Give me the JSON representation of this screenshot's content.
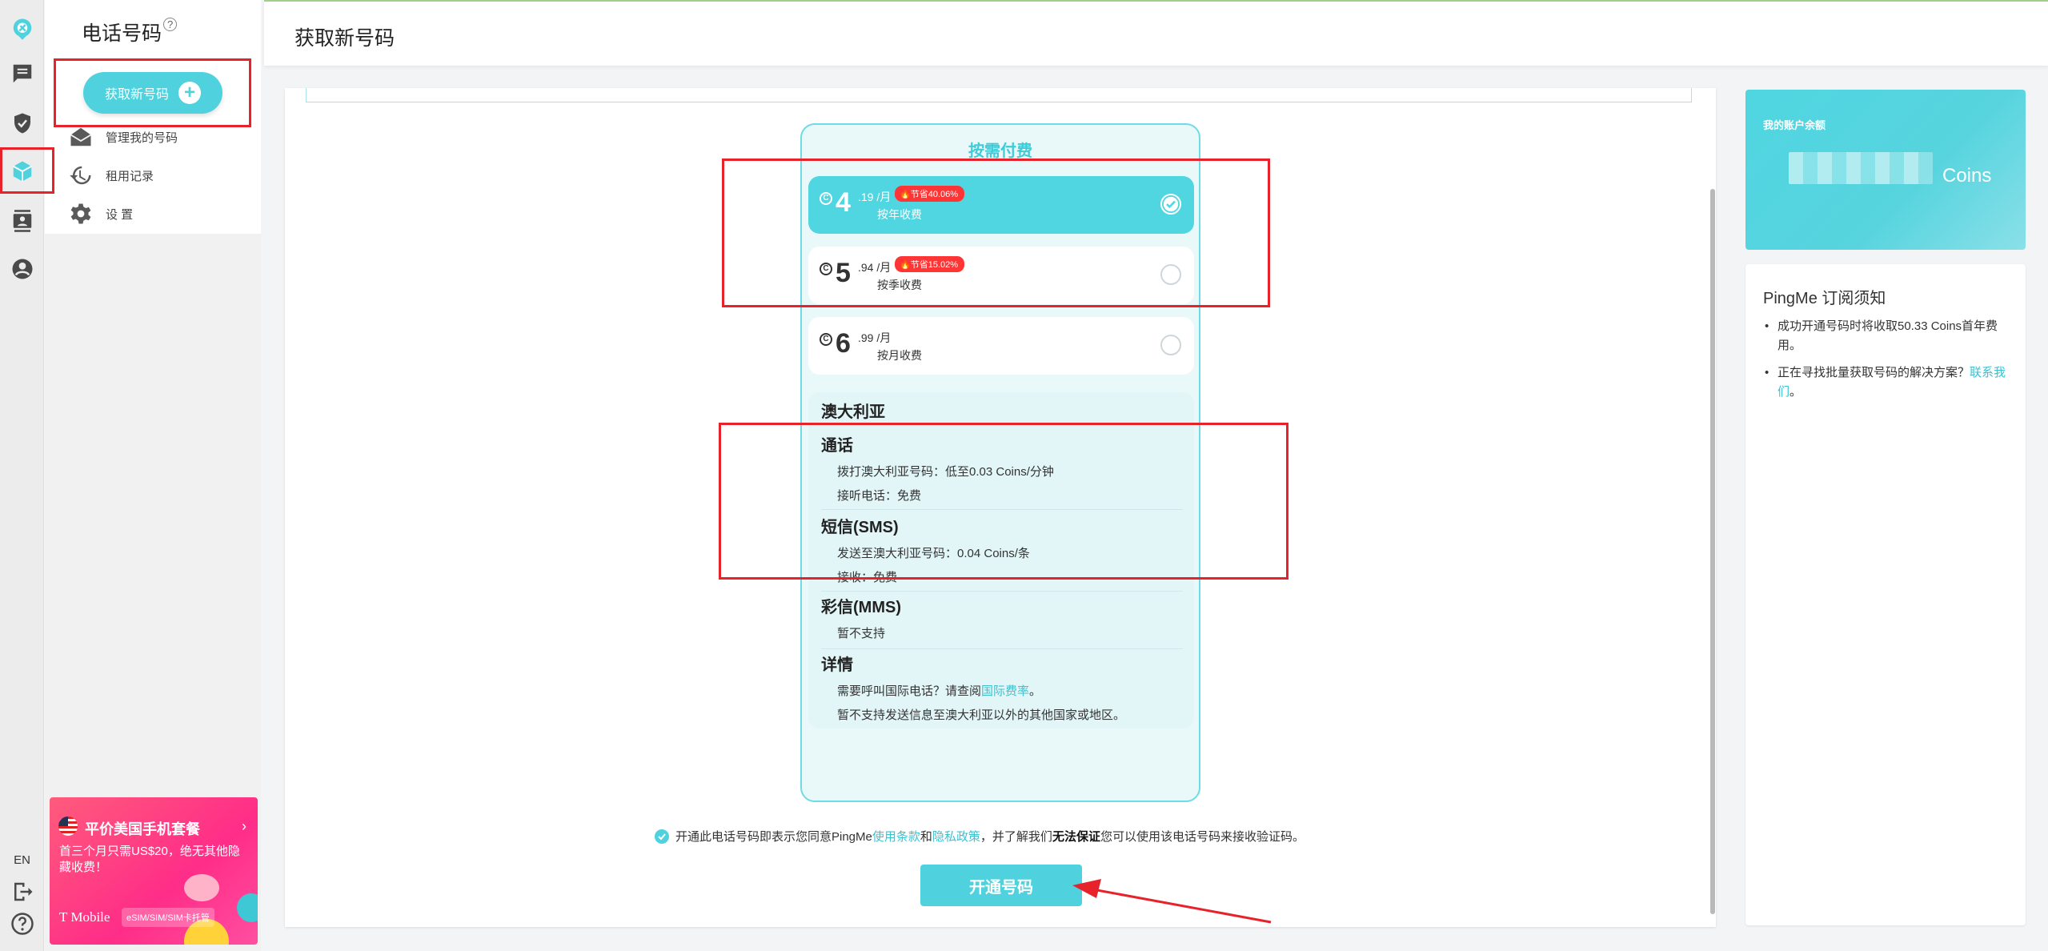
{
  "rail": {
    "items": [
      {
        "name": "app-logo-icon"
      },
      {
        "name": "messages-icon"
      },
      {
        "name": "shield-check-icon"
      },
      {
        "name": "phone-number-icon"
      },
      {
        "name": "contacts-icon"
      },
      {
        "name": "account-icon"
      }
    ],
    "lang": "EN"
  },
  "subnav": {
    "title": "电话号码",
    "help_mark": "?",
    "get_number_label": "获取新号码",
    "items": [
      {
        "label": "管理我的号码",
        "icon": "mail-open-icon"
      },
      {
        "label": "租用记录",
        "icon": "history-icon"
      },
      {
        "label": "设 置",
        "icon": "gear-icon"
      }
    ]
  },
  "promo": {
    "title": "平价美国手机套餐",
    "arrow": "›",
    "text": "首三个月只需US$20，绝无其他隐藏收费！",
    "logo": "T Mobile",
    "tag": "eSIM/SIM/SIM卡托管"
  },
  "header": {
    "title": "获取新号码"
  },
  "plans": {
    "heading": "按需付费",
    "options": [
      {
        "int": "4",
        "dec": ".19 /月",
        "save": "节省40.06%",
        "cycle": "按年收费",
        "selected": true
      },
      {
        "int": "5",
        "dec": ".94 /月",
        "save": "节省15.02%",
        "cycle": "按季收费",
        "selected": false
      },
      {
        "int": "6",
        "dec": ".99 /月",
        "save": "",
        "cycle": "按月收费",
        "selected": false
      }
    ],
    "coin_symbol": "C"
  },
  "details": {
    "country": "澳大利亚",
    "calls": {
      "title": "通话",
      "lines": [
        "拨打澳大利亚号码：低至0.03 Coins/分钟",
        "接听电话：免费"
      ]
    },
    "sms": {
      "title": "短信(SMS)",
      "lines": [
        "发送至澳大利亚号码：0.04 Coins/条",
        "接收：免费"
      ]
    },
    "mms": {
      "title": "彩信(MMS)",
      "lines": [
        "暂不支持"
      ]
    },
    "info": {
      "title": "详情",
      "line1_pre": "需要呼叫国际电话？请查阅",
      "line1_link": "国际费率",
      "line1_post": "。",
      "line2": "暂不支持发送信息至澳大利亚以外的其他国家或地区。"
    }
  },
  "agreement": {
    "pre": "开通此电话号码即表示您同意PingMe",
    "terms": "使用条款",
    "and": "和",
    "privacy": "隐私政策",
    "mid": "，并了解我们",
    "bold": "无法保证",
    "post": "您可以使用该电话号码来接收验证码。"
  },
  "open_button": "开通号码",
  "balance": {
    "label": "我的账户余额",
    "unit": "Coins"
  },
  "notice": {
    "title": "PingMe 订阅须知",
    "item1": "成功开通号码时将收取50.33 Coins首年费用。",
    "item2_pre": "正在寻找批量获取号码的解决方案？",
    "item2_link": "联系我们",
    "item2_post": "。"
  },
  "colors": {
    "accent": "#4fd2dd",
    "annotation": "#e8222a",
    "save_badge": "#ff3535"
  }
}
